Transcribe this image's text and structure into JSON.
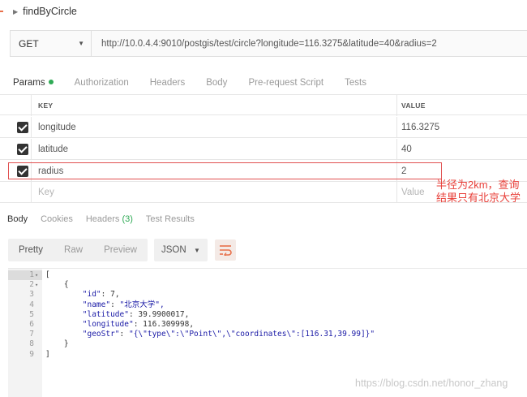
{
  "request": {
    "title": "findByCircle",
    "method": "GET",
    "url": "http://10.0.4.4:9010/postgis/test/circle?longitude=116.3275&latitude=40&radius=2"
  },
  "request_tabs": [
    "Params",
    "Authorization",
    "Headers",
    "Body",
    "Pre-request Script",
    "Tests"
  ],
  "params": {
    "key_header": "KEY",
    "value_header": "VALUE",
    "rows": [
      {
        "key": "longitude",
        "value": "116.3275",
        "checked": true
      },
      {
        "key": "latitude",
        "value": "40",
        "checked": true
      },
      {
        "key": "radius",
        "value": "2",
        "checked": true
      }
    ],
    "key_placeholder": "Key",
    "value_placeholder": "Value"
  },
  "annotation": "半径为2km，查询结果只有北京大学",
  "response_tabs": {
    "body": "Body",
    "cookies": "Cookies",
    "headers": "Headers",
    "headers_count": "(3)",
    "test_results": "Test Results"
  },
  "response_toolbar": {
    "pretty": "Pretty",
    "raw": "Raw",
    "preview": "Preview",
    "format": "JSON"
  },
  "response_body": {
    "lines": [
      {
        "no": "1",
        "fold": "▾",
        "text": "["
      },
      {
        "no": "2",
        "fold": "▾",
        "text": "    {"
      },
      {
        "no": "3",
        "fold": "",
        "text": "        \"id\": 7,"
      },
      {
        "no": "4",
        "fold": "",
        "text": "        \"name\": \"北京大学\","
      },
      {
        "no": "5",
        "fold": "",
        "text": "        \"latitude\": 39.9900017,"
      },
      {
        "no": "6",
        "fold": "",
        "text": "        \"longitude\": 116.309998,"
      },
      {
        "no": "7",
        "fold": "",
        "text": "        \"geoStr\": \"{\\\"type\\\":\\\"Point\\\",\\\"coordinates\\\":[116.31,39.99]}\""
      },
      {
        "no": "8",
        "fold": "",
        "text": "    }"
      },
      {
        "no": "9",
        "fold": "",
        "text": "]"
      }
    ]
  },
  "watermark": "https://blog.csdn.net/honor_zhang",
  "colors": {
    "accent": "#e8704a",
    "active_dot": "#2faa55",
    "annotation": "#e8403a"
  }
}
